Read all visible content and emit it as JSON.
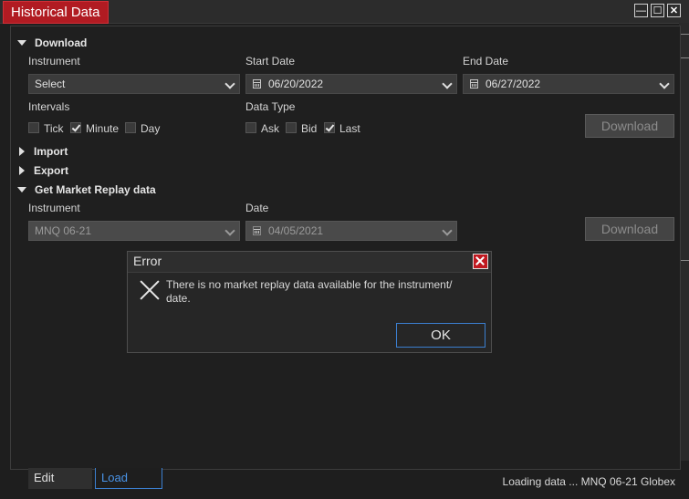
{
  "window": {
    "title": "Historical Data",
    "minimize": "—",
    "maximize": "☐",
    "close": "✕"
  },
  "download": {
    "header": "Download",
    "instrument_label": "Instrument",
    "instrument_value": "Select",
    "start_label": "Start Date",
    "start_value": "06/20/2022",
    "end_label": "End Date",
    "end_value": "06/27/2022",
    "intervals_label": "Intervals",
    "intervals": [
      {
        "label": "Tick",
        "checked": false
      },
      {
        "label": "Minute",
        "checked": true
      },
      {
        "label": "Day",
        "checked": false
      }
    ],
    "datatype_label": "Data Type",
    "datatypes": [
      {
        "label": "Ask",
        "checked": false
      },
      {
        "label": "Bid",
        "checked": false
      },
      {
        "label": "Last",
        "checked": true
      }
    ],
    "button": "Download"
  },
  "import": {
    "header": "Import"
  },
  "export": {
    "header": "Export"
  },
  "replay": {
    "header": "Get Market Replay data",
    "instrument_label": "Instrument",
    "instrument_value": "MNQ 06-21",
    "date_label": "Date",
    "date_value": "04/05/2021",
    "button": "Download"
  },
  "dialog": {
    "title": "Error",
    "message": "There is no market replay data available for the instrument/ date.",
    "ok": "OK"
  },
  "tabs": [
    {
      "label": "Edit",
      "active": false
    },
    {
      "label": "Load",
      "active": true
    }
  ],
  "status": "Loading data ... MNQ 06-21 Globex",
  "colors": {
    "accent": "#b11b22",
    "active_tab": "#3b7fd0",
    "background": "#1e1e1e"
  }
}
